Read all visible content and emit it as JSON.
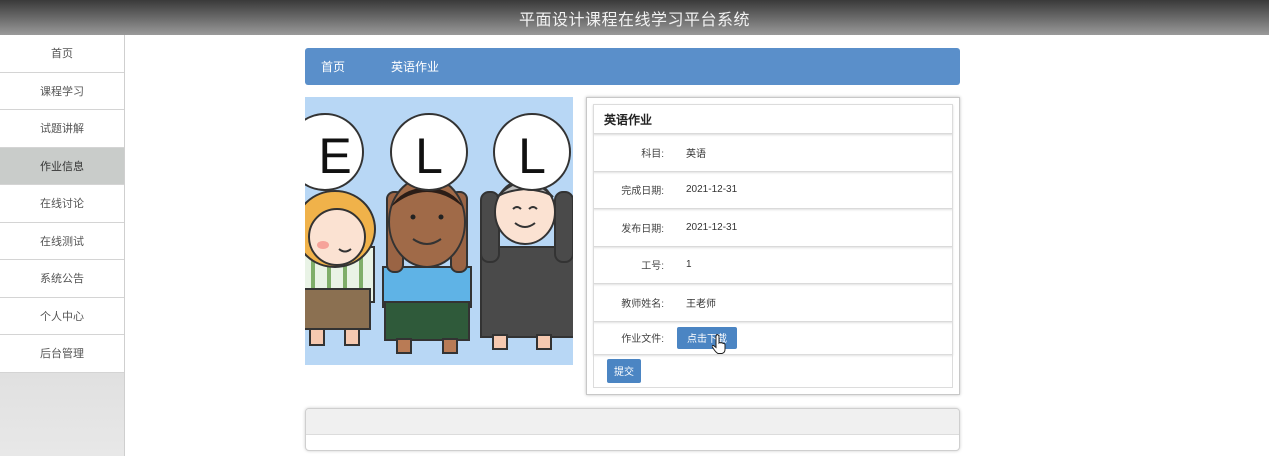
{
  "app": {
    "title": "平面设计课程在线学习平台系统"
  },
  "sidebar": {
    "items": [
      {
        "label": "首页"
      },
      {
        "label": "课程学习"
      },
      {
        "label": "试题讲解"
      },
      {
        "label": "作业信息"
      },
      {
        "label": "在线讨论"
      },
      {
        "label": "在线测试"
      },
      {
        "label": "系统公告"
      },
      {
        "label": "个人中心"
      },
      {
        "label": "后台管理"
      }
    ],
    "active_index": 3
  },
  "breadcrumb": {
    "home": "首页",
    "current": "英语作业"
  },
  "illustration": {
    "letters": [
      "E",
      "L",
      "L"
    ]
  },
  "detail": {
    "title": "英语作业",
    "fields": [
      {
        "label": "科目:",
        "value": "英语"
      },
      {
        "label": "完成日期:",
        "value": "2021-12-31"
      },
      {
        "label": "发布日期:",
        "value": "2021-12-31"
      },
      {
        "label": "工号:",
        "value": "1"
      },
      {
        "label": "教师姓名:",
        "value": "王老师"
      }
    ],
    "file_label": "作业文件:",
    "download_label": "点击下载",
    "submit_label": "提交"
  },
  "colors": {
    "accent": "#5a8fca",
    "button": "#4b85c3",
    "topbar": "#5a5a5a"
  }
}
